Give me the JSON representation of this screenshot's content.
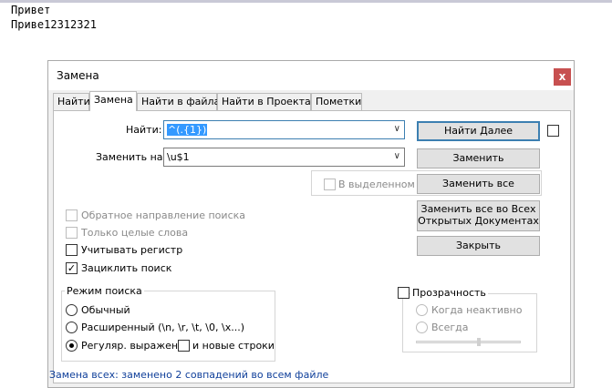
{
  "editor": {
    "line1": "Привет",
    "line2": "Приве12312321"
  },
  "dialog": {
    "title": "Замена",
    "close_glyph": "x",
    "tabs": [
      "Найти",
      "Замена",
      "Найти в файлах",
      "Найти в Проектах",
      "Пометки"
    ],
    "find_label": "Найти:",
    "find_value": "^(.{1})",
    "replace_label": "Заменить на:",
    "replace_value": "\\u$1",
    "in_selection_label": "В выделенном",
    "options": {
      "backward": "Обратное направление поиска",
      "whole_word": "Только целые слова",
      "match_case": "Учитывать регистр",
      "wrap": "Зациклить поиск",
      "check_glyph": "✓"
    },
    "search_mode": {
      "title": "Режим поиска",
      "normal": "Обычный",
      "extended": "Расширенный (\\n, \\r, \\t, \\0, \\x...)",
      "regex": "Регуляр. выражен.",
      "newline": "и новые строки"
    },
    "transparency": {
      "title": "Прозрачность",
      "on_inactive": "Когда неактивно",
      "always": "Всегда",
      "level": 0.6
    },
    "buttons": {
      "find_next": "Найти Далее",
      "replace": "Заменить",
      "replace_all": "Заменить все",
      "replace_all_docs_line1": "Заменить все во Всех",
      "replace_all_docs_line2": "Открытых Документах",
      "close": "Закрыть"
    },
    "status": "Замена всех: заменено 2 совпадений во всем файле"
  },
  "colors": {
    "accent": "#3c7fb1",
    "selection": "#3399ff",
    "close_bg": "#c75050",
    "status_text": "#0f3f9a"
  }
}
